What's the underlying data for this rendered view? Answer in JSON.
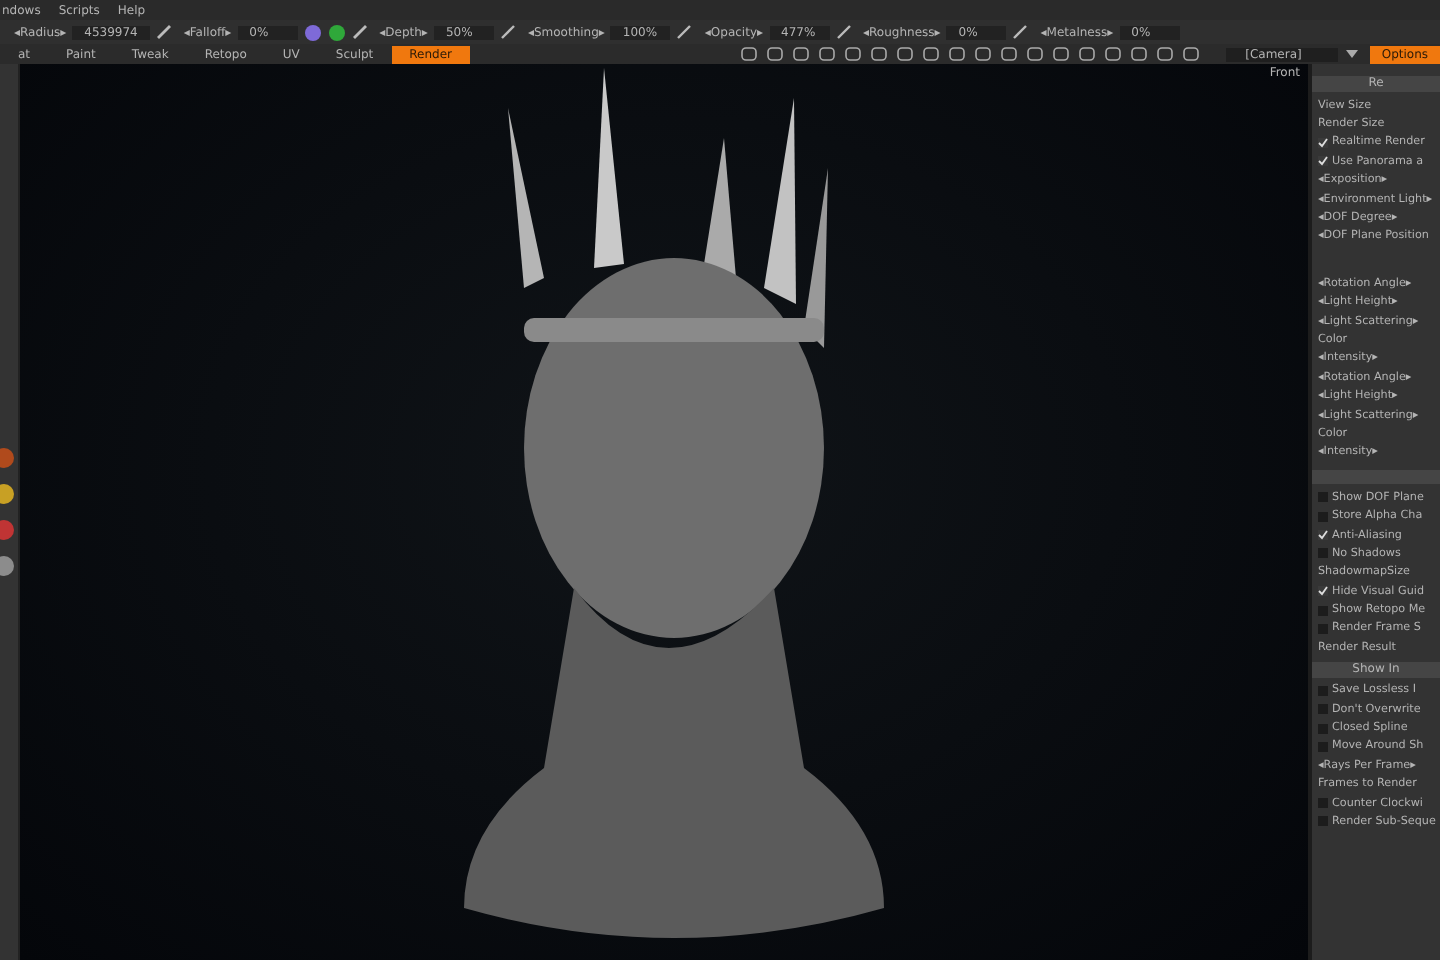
{
  "menu": [
    "ndows",
    "Scripts",
    "Help"
  ],
  "toolbar": {
    "params": [
      {
        "label": "◂Radius▸",
        "value": "4539974"
      },
      {
        "label": "◂Falloff▸",
        "value": "0%"
      },
      {
        "label": "◂Depth▸",
        "value": "50%"
      },
      {
        "label": "◂Smoothing▸",
        "value": "100%"
      },
      {
        "label": "◂Opacity▸",
        "value": "477%"
      },
      {
        "label": "◂Roughness▸",
        "value": "0%"
      },
      {
        "label": "◂Metalness▸",
        "value": "0%"
      }
    ],
    "camera": "[Camera]"
  },
  "tabs": [
    {
      "label": "at",
      "selected": false
    },
    {
      "label": "Paint",
      "selected": false
    },
    {
      "label": "Tweak",
      "selected": false
    },
    {
      "label": "Retopo",
      "selected": false
    },
    {
      "label": "UV",
      "selected": false
    },
    {
      "label": "Sculpt",
      "selected": false
    },
    {
      "label": "Render",
      "selected": true
    }
  ],
  "panel_tabs": [
    {
      "label": "Options",
      "selected": true
    }
  ],
  "viewport": {
    "view_label": "Front"
  },
  "left_tools": [
    {
      "color": "#b04a1c"
    },
    {
      "color": "#c8a024"
    },
    {
      "color": "#c03434"
    },
    {
      "color": "#8c8c8c"
    }
  ],
  "panel": {
    "sections": [
      {
        "kind": "titled",
        "header": "Re",
        "items": [
          {
            "kind": "label",
            "text": "View Size"
          },
          {
            "kind": "label",
            "text": "Render Size"
          },
          {
            "kind": "check",
            "text": "Realtime Render",
            "checked": true
          },
          {
            "kind": "check",
            "text": "Use Panorama a",
            "checked": true
          },
          {
            "kind": "label",
            "text": "◂Exposition▸"
          },
          {
            "kind": "label",
            "text": "◂Environment Light▸"
          },
          {
            "kind": "label",
            "text": "◂DOF Degree▸"
          },
          {
            "kind": "label",
            "text": "◂DOF Plane Position"
          }
        ]
      },
      {
        "kind": "spaced",
        "items": [
          {
            "kind": "label",
            "text": "◂Rotation Angle▸"
          },
          {
            "kind": "label",
            "text": "◂Light Height▸"
          },
          {
            "kind": "label",
            "text": "◂Light Scattering▸"
          },
          {
            "kind": "label",
            "text": "Color"
          },
          {
            "kind": "label",
            "text": "◂Intensity▸"
          },
          {
            "kind": "label",
            "text": "◂Rotation Angle▸"
          },
          {
            "kind": "label",
            "text": "◂Light Height▸"
          },
          {
            "kind": "label",
            "text": "◂Light Scattering▸"
          },
          {
            "kind": "label",
            "text": "Color"
          },
          {
            "kind": "label",
            "text": "◂Intensity▸"
          }
        ]
      },
      {
        "kind": "barred",
        "items": [
          {
            "kind": "check",
            "text": "Show DOF Plane",
            "checked": false
          },
          {
            "kind": "check",
            "text": "Store Alpha Cha",
            "checked": false
          },
          {
            "kind": "check",
            "text": "Anti-Aliasing",
            "checked": true
          },
          {
            "kind": "check",
            "text": "No Shadows",
            "checked": false
          },
          {
            "kind": "label",
            "text": "ShadowmapSize"
          },
          {
            "kind": "check",
            "text": "Hide Visual Guid",
            "checked": true
          },
          {
            "kind": "check",
            "text": "Show Retopo Me",
            "checked": false
          },
          {
            "kind": "check",
            "text": "Render Frame S",
            "checked": false
          },
          {
            "kind": "label",
            "text": "Render Result"
          }
        ]
      },
      {
        "kind": "titled",
        "header": "Show In",
        "items": [
          {
            "kind": "check",
            "text": "Save Lossless I",
            "checked": false
          },
          {
            "kind": "check",
            "text": "Don't Overwrite",
            "checked": false
          },
          {
            "kind": "check",
            "text": "Closed Spline",
            "checked": false
          },
          {
            "kind": "check",
            "text": "Move Around Sh",
            "checked": false
          },
          {
            "kind": "label",
            "text": "◂Rays Per Frame▸"
          },
          {
            "kind": "label",
            "text": "Frames to Render"
          },
          {
            "kind": "check",
            "text": "Counter Clockwi",
            "checked": false
          },
          {
            "kind": "check",
            "text": "Render Sub-Seque",
            "checked": false
          }
        ]
      }
    ]
  }
}
